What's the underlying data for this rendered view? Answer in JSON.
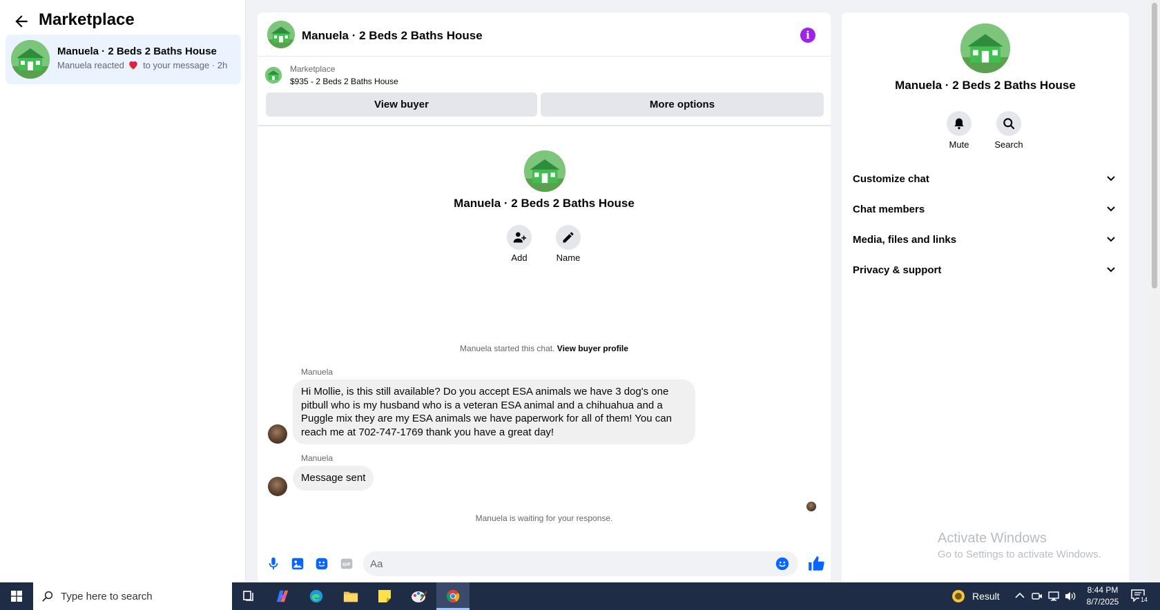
{
  "left_panel": {
    "title": "Marketplace",
    "conversation": {
      "name": "Manuela · 2 Beds 2 Baths House",
      "preview_prefix": "Manuela reacted",
      "preview_suffix": "to your message",
      "time": "· 2h"
    }
  },
  "chat_header": {
    "title": "Manuela · 2 Beds 2 Baths House"
  },
  "marketplace_card": {
    "label": "Marketplace",
    "listing": "$935 - 2 Beds 2 Baths House",
    "view_buyer": "View buyer",
    "more_options": "More options"
  },
  "chat_intro": {
    "title": "Manuela · 2 Beds 2 Baths House",
    "add_label": "Add",
    "name_label": "Name"
  },
  "messages": {
    "started_text": "Manuela started this chat.",
    "started_link": "View buyer profile",
    "msg1_sender": "Manuela",
    "msg1_text": "Hi Mollie, is this still available? Do you accept ESA animals we have 3 dog's one pitbull who is my husband who is a veteran ESA animal and a chihuahua and a Puggle mix they are my ESA animals we have paperwork for all of them! You can reach me at 702-747-1769 thank you have a great day!",
    "msg2_sender": "Manuela",
    "msg2_text": "Message sent",
    "waiting": "Manuela is waiting for your response."
  },
  "composer": {
    "placeholder": "Aa"
  },
  "right_panel": {
    "name": "Manuela · 2 Beds 2 Baths House",
    "mute_label": "Mute",
    "search_label": "Search",
    "sections": [
      "Customize chat",
      "Chat members",
      "Media, files and links",
      "Privacy & support"
    ]
  },
  "watermark": {
    "line1": "Activate Windows",
    "line2": "Go to Settings to activate Windows."
  },
  "taskbar": {
    "search_placeholder": "Type here to search",
    "result_label": "Result",
    "time": "8:44 PM",
    "date": "8/7/2025",
    "notification_count": "14"
  },
  "colors": {
    "accent": "#0866ff",
    "info": "#a021e8",
    "heart": "#e41e3f",
    "taskbar": "#1f2c46"
  }
}
